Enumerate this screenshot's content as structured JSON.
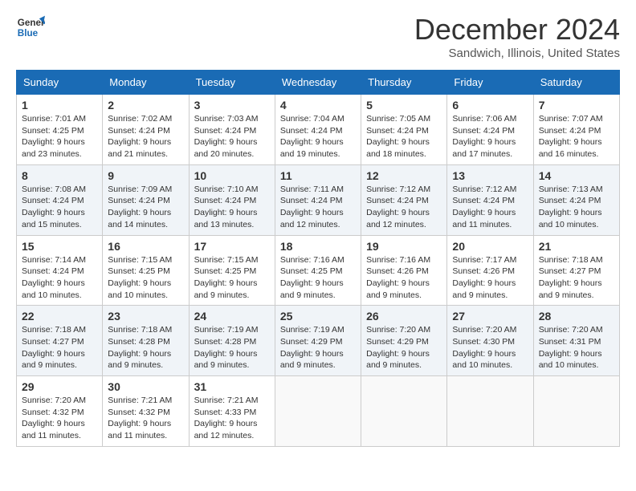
{
  "logo": {
    "line1": "General",
    "line2": "Blue"
  },
  "title": "December 2024",
  "subtitle": "Sandwich, Illinois, United States",
  "days_of_week": [
    "Sunday",
    "Monday",
    "Tuesday",
    "Wednesday",
    "Thursday",
    "Friday",
    "Saturday"
  ],
  "weeks": [
    [
      {
        "day": "1",
        "sunrise": "7:01 AM",
        "sunset": "4:25 PM",
        "daylight": "9 hours and 23 minutes."
      },
      {
        "day": "2",
        "sunrise": "7:02 AM",
        "sunset": "4:24 PM",
        "daylight": "9 hours and 21 minutes."
      },
      {
        "day": "3",
        "sunrise": "7:03 AM",
        "sunset": "4:24 PM",
        "daylight": "9 hours and 20 minutes."
      },
      {
        "day": "4",
        "sunrise": "7:04 AM",
        "sunset": "4:24 PM",
        "daylight": "9 hours and 19 minutes."
      },
      {
        "day": "5",
        "sunrise": "7:05 AM",
        "sunset": "4:24 PM",
        "daylight": "9 hours and 18 minutes."
      },
      {
        "day": "6",
        "sunrise": "7:06 AM",
        "sunset": "4:24 PM",
        "daylight": "9 hours and 17 minutes."
      },
      {
        "day": "7",
        "sunrise": "7:07 AM",
        "sunset": "4:24 PM",
        "daylight": "9 hours and 16 minutes."
      }
    ],
    [
      {
        "day": "8",
        "sunrise": "7:08 AM",
        "sunset": "4:24 PM",
        "daylight": "9 hours and 15 minutes."
      },
      {
        "day": "9",
        "sunrise": "7:09 AM",
        "sunset": "4:24 PM",
        "daylight": "9 hours and 14 minutes."
      },
      {
        "day": "10",
        "sunrise": "7:10 AM",
        "sunset": "4:24 PM",
        "daylight": "9 hours and 13 minutes."
      },
      {
        "day": "11",
        "sunrise": "7:11 AM",
        "sunset": "4:24 PM",
        "daylight": "9 hours and 12 minutes."
      },
      {
        "day": "12",
        "sunrise": "7:12 AM",
        "sunset": "4:24 PM",
        "daylight": "9 hours and 12 minutes."
      },
      {
        "day": "13",
        "sunrise": "7:12 AM",
        "sunset": "4:24 PM",
        "daylight": "9 hours and 11 minutes."
      },
      {
        "day": "14",
        "sunrise": "7:13 AM",
        "sunset": "4:24 PM",
        "daylight": "9 hours and 10 minutes."
      }
    ],
    [
      {
        "day": "15",
        "sunrise": "7:14 AM",
        "sunset": "4:24 PM",
        "daylight": "9 hours and 10 minutes."
      },
      {
        "day": "16",
        "sunrise": "7:15 AM",
        "sunset": "4:25 PM",
        "daylight": "9 hours and 10 minutes."
      },
      {
        "day": "17",
        "sunrise": "7:15 AM",
        "sunset": "4:25 PM",
        "daylight": "9 hours and 9 minutes."
      },
      {
        "day": "18",
        "sunrise": "7:16 AM",
        "sunset": "4:25 PM",
        "daylight": "9 hours and 9 minutes."
      },
      {
        "day": "19",
        "sunrise": "7:16 AM",
        "sunset": "4:26 PM",
        "daylight": "9 hours and 9 minutes."
      },
      {
        "day": "20",
        "sunrise": "7:17 AM",
        "sunset": "4:26 PM",
        "daylight": "9 hours and 9 minutes."
      },
      {
        "day": "21",
        "sunrise": "7:18 AM",
        "sunset": "4:27 PM",
        "daylight": "9 hours and 9 minutes."
      }
    ],
    [
      {
        "day": "22",
        "sunrise": "7:18 AM",
        "sunset": "4:27 PM",
        "daylight": "9 hours and 9 minutes."
      },
      {
        "day": "23",
        "sunrise": "7:18 AM",
        "sunset": "4:28 PM",
        "daylight": "9 hours and 9 minutes."
      },
      {
        "day": "24",
        "sunrise": "7:19 AM",
        "sunset": "4:28 PM",
        "daylight": "9 hours and 9 minutes."
      },
      {
        "day": "25",
        "sunrise": "7:19 AM",
        "sunset": "4:29 PM",
        "daylight": "9 hours and 9 minutes."
      },
      {
        "day": "26",
        "sunrise": "7:20 AM",
        "sunset": "4:29 PM",
        "daylight": "9 hours and 9 minutes."
      },
      {
        "day": "27",
        "sunrise": "7:20 AM",
        "sunset": "4:30 PM",
        "daylight": "9 hours and 10 minutes."
      },
      {
        "day": "28",
        "sunrise": "7:20 AM",
        "sunset": "4:31 PM",
        "daylight": "9 hours and 10 minutes."
      }
    ],
    [
      {
        "day": "29",
        "sunrise": "7:20 AM",
        "sunset": "4:32 PM",
        "daylight": "9 hours and 11 minutes."
      },
      {
        "day": "30",
        "sunrise": "7:21 AM",
        "sunset": "4:32 PM",
        "daylight": "9 hours and 11 minutes."
      },
      {
        "day": "31",
        "sunrise": "7:21 AM",
        "sunset": "4:33 PM",
        "daylight": "9 hours and 12 minutes."
      },
      null,
      null,
      null,
      null
    ]
  ],
  "labels": {
    "sunrise": "Sunrise:",
    "sunset": "Sunset:",
    "daylight": "Daylight:"
  }
}
